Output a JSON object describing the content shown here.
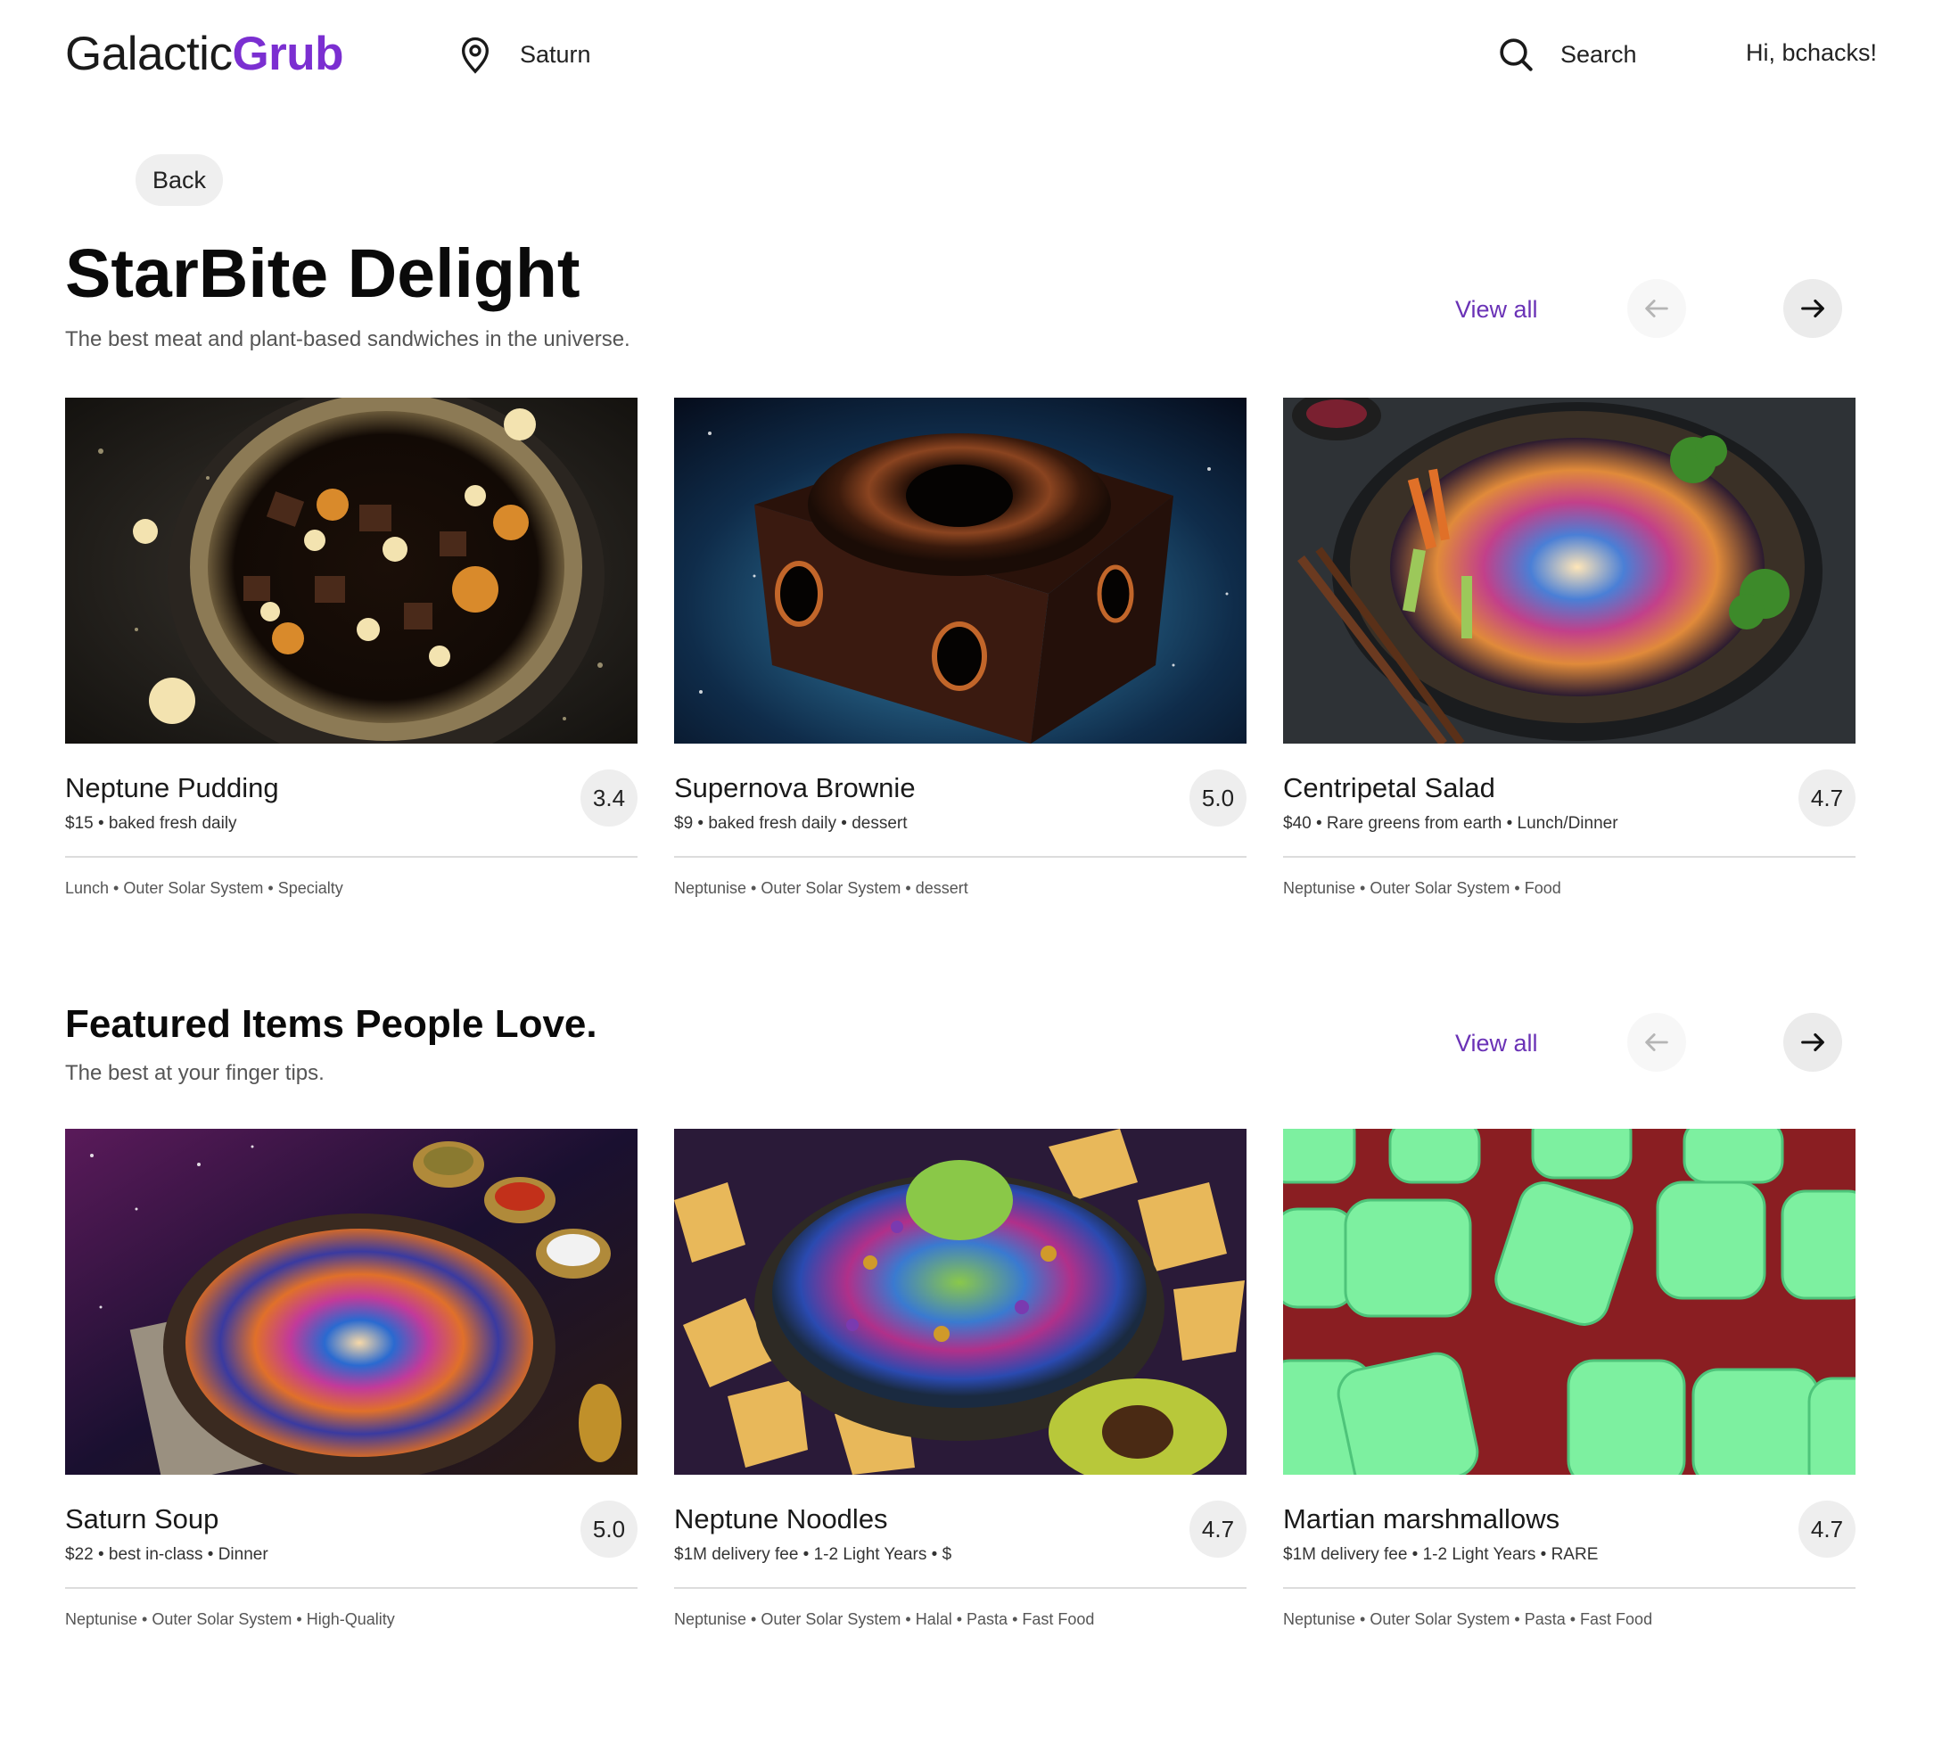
{
  "header": {
    "logo_main": "Galactic",
    "logo_accent": "Grub",
    "location": "Saturn",
    "search_label": "Search",
    "greeting": "Hi, bchacks!"
  },
  "back_label": "Back",
  "colors": {
    "accent": "#7b2fd1",
    "view_all": "#6a32b6"
  },
  "sections": [
    {
      "title": "StarBite Delight",
      "subtitle": "The best meat and plant-based sandwiches in the universe.",
      "view_all": "View all",
      "items": [
        {
          "name": "Neptune Pudding",
          "meta": "$15 • baked fresh daily",
          "rating": "3.4",
          "tags": "Lunch • Outer Solar System • Specialty",
          "image": "space-stew-bowl"
        },
        {
          "name": "Supernova Brownie",
          "meta": "$9 • baked fresh daily • dessert",
          "rating": "5.0",
          "tags": "Neptunise • Outer Solar System • dessert",
          "image": "black-hole-brownie"
        },
        {
          "name": "Centripetal Salad",
          "meta": "$40 • Rare greens from earth • Lunch/Dinner",
          "rating": "4.7",
          "tags": "Neptunise • Outer Solar System • Food",
          "image": "nebula-noodle-salad"
        }
      ]
    },
    {
      "title": "Featured Items People Love.",
      "subtitle": "The best at your finger tips.",
      "view_all": "View all",
      "items": [
        {
          "name": "Saturn Soup",
          "meta": "$22 • best in-class • Dinner",
          "rating": "5.0",
          "tags": "Neptunise • Outer Solar System • High-Quality",
          "image": "galaxy-soup"
        },
        {
          "name": "Neptune Noodles",
          "meta": "$1M delivery fee • 1-2 Light Years • $",
          "rating": "4.7",
          "tags": "Neptunise • Outer Solar System • Halal • Pasta • Fast Food",
          "image": "cosmic-guacamole"
        },
        {
          "name": "Martian marshmallows",
          "meta": "$1M delivery fee • 1-2 Light Years • RARE",
          "rating": "4.7",
          "tags": "Neptunise • Outer Solar System • Pasta • Fast Food",
          "image": "green-marshmallows"
        }
      ]
    }
  ]
}
